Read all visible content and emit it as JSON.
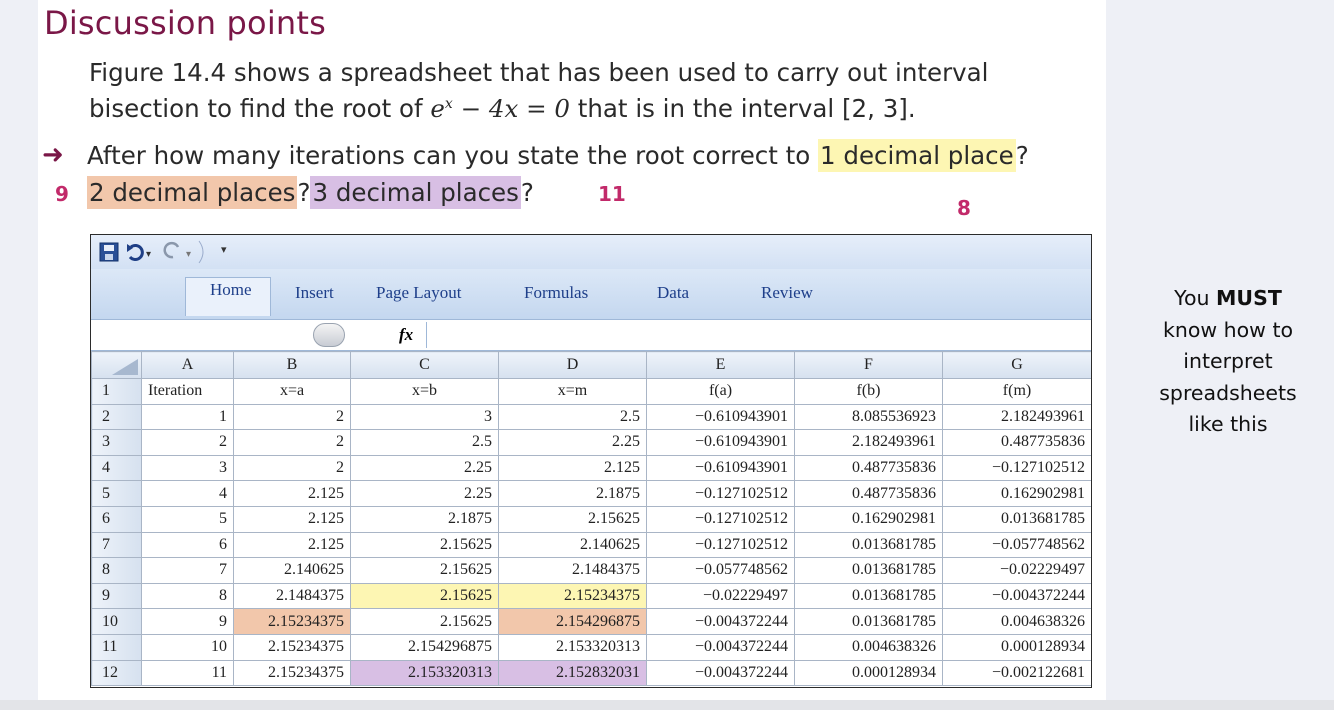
{
  "heading": "Discussion points",
  "paragraph": {
    "line1": "Figure 14.4 shows a spreadsheet that has been used to carry out interval",
    "line2_before": "bisection to find the root of ",
    "line2_math_base": "e",
    "line2_math_sup": "x",
    "line2_math_rest": " − 4x = 0",
    "line2_after": " that is in the interval [2, 3]."
  },
  "question": {
    "before": "After how many iterations can you state the root correct to ",
    "hl1": "1 decimal place",
    "q": "?",
    "hl2": "2 decimal places",
    "hl3": "3 decimal places"
  },
  "answers": {
    "a1": "8",
    "a2": "9",
    "a3": "11"
  },
  "side_note": {
    "line1_a": "You ",
    "line1_b": "MUST",
    "line2": "know how to",
    "line3": "interpret",
    "line4": "spreadsheets",
    "line5": "like this"
  },
  "excel": {
    "qat_arrow": "▾",
    "tabs": {
      "home": "Home",
      "insert": "Insert",
      "page_layout": "Page Layout",
      "formulas": "Formulas",
      "data": "Data",
      "review": "Review"
    },
    "fx": "fx",
    "columns": [
      "A",
      "B",
      "C",
      "D",
      "E",
      "F",
      "G"
    ],
    "rows": [
      [
        "1",
        "Iteration",
        "x=a",
        "x=b",
        "x=m",
        "f(a)",
        "f(b)",
        "f(m)"
      ],
      [
        "2",
        "1",
        "2",
        "3",
        "2.5",
        "−0.610943901",
        "8.085536923",
        "2.182493961"
      ],
      [
        "3",
        "2",
        "2",
        "2.5",
        "2.25",
        "−0.610943901",
        "2.182493961",
        "0.487735836"
      ],
      [
        "4",
        "3",
        "2",
        "2.25",
        "2.125",
        "−0.610943901",
        "0.487735836",
        "−0.127102512"
      ],
      [
        "5",
        "4",
        "2.125",
        "2.25",
        "2.1875",
        "−0.127102512",
        "0.487735836",
        "0.162902981"
      ],
      [
        "6",
        "5",
        "2.125",
        "2.1875",
        "2.15625",
        "−0.127102512",
        "0.162902981",
        "0.013681785"
      ],
      [
        "7",
        "6",
        "2.125",
        "2.15625",
        "2.140625",
        "−0.127102512",
        "0.013681785",
        "−0.057748562"
      ],
      [
        "8",
        "7",
        "2.140625",
        "2.15625",
        "2.1484375",
        "−0.057748562",
        "0.013681785",
        "−0.02229497"
      ],
      [
        "9",
        "8",
        "2.1484375",
        "2.15625",
        "2.15234375",
        "−0.02229497",
        "0.013681785",
        "−0.004372244"
      ],
      [
        "10",
        "9",
        "2.15234375",
        "2.15625",
        "2.154296875",
        "−0.004372244",
        "0.013681785",
        "0.004638326"
      ],
      [
        "11",
        "10",
        "2.15234375",
        "2.154296875",
        "2.153320313",
        "−0.004372244",
        "0.004638326",
        "0.000128934"
      ],
      [
        "12",
        "11",
        "2.15234375",
        "2.153320313",
        "2.152832031",
        "−0.004372244",
        "0.000128934",
        "−0.002122681"
      ]
    ]
  }
}
